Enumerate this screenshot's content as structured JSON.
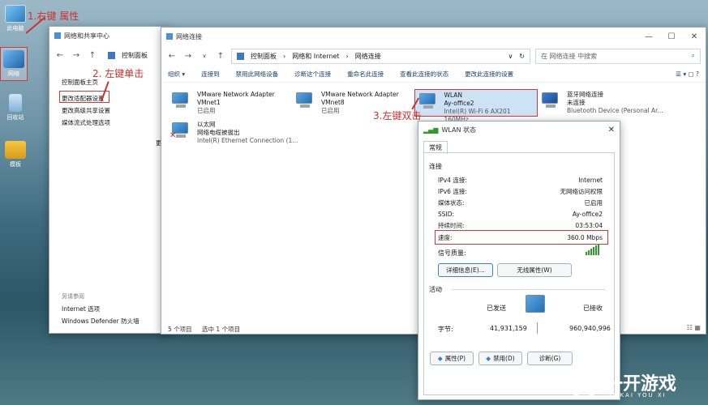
{
  "desktop": {
    "icons": [
      {
        "label": "此电脑"
      },
      {
        "label": "网络"
      },
      {
        "label": "回收站"
      },
      {
        "label": "模板"
      }
    ]
  },
  "annotations": {
    "step1": "1.右键 属性",
    "step2": "2. 左键单击",
    "step3": "3.左键双击"
  },
  "nsc_window": {
    "title": "网络和共享中心",
    "breadcrumb": "控制面板",
    "left_links": [
      "控制面板主页",
      "更改适配器设置",
      "更改高级共享设置",
      "媒体流式处理选项"
    ],
    "see_also": "另请参阅",
    "see_also_links": [
      "Internet 选项",
      "Windows Defender 防火墙"
    ],
    "partial_text": "更"
  },
  "net_window": {
    "title": "网络连接",
    "breadcrumb": [
      "控制面板",
      "网络和 Internet",
      "网络连接"
    ],
    "search_placeholder": "在 网络连接 中搜索",
    "commands": [
      "组织 ▾",
      "连接到",
      "禁用此网络设备",
      "诊断这个连接",
      "重命名此连接",
      "查看此连接的状态",
      "更改此连接的设置"
    ],
    "adapters": [
      {
        "name": "VMware Network Adapter",
        "line2": "VMnet1",
        "line3": "已启用"
      },
      {
        "name": "VMware Network Adapter",
        "line2": "VMnet8",
        "line3": "已启用"
      },
      {
        "name": "WLAN",
        "line2": "Ay-office2",
        "line3": "Intel(R) Wi-Fi 6 AX201 160MHz"
      },
      {
        "name": "蓝牙网络连接",
        "line2": "未连接",
        "line3": "Bluetooth Device (Personal Ar..."
      },
      {
        "name": "以太网",
        "line2": "网络电缆被拔出",
        "line3": "Intel(R) Ethernet Connection (1..."
      }
    ],
    "status_items": "5 个项目",
    "status_selected": "选中 1 个项目"
  },
  "wlan_dialog": {
    "title": "WLAN 状态",
    "tab": "常规",
    "section_connection": "连接",
    "rows": [
      {
        "k": "IPv4 连接:",
        "v": "Internet"
      },
      {
        "k": "IPv6 连接:",
        "v": "无网络访问权限"
      },
      {
        "k": "媒体状态:",
        "v": "已启用"
      },
      {
        "k": "SSID:",
        "v": "Ay-office2"
      },
      {
        "k": "持续时间:",
        "v": "03:53:04"
      },
      {
        "k": "速度:",
        "v": "360.0 Mbps"
      }
    ],
    "signal_label": "信号质量:",
    "btn_details": "详细信息(E)...",
    "btn_wireless": "无线属性(W)",
    "section_activity": "活动",
    "sent_label": "已发送",
    "recv_label": "已接收",
    "bytes_label": "字节:",
    "bytes_sent": "41,931,159",
    "bytes_recv": "960,940,996",
    "btn_props": "属性(P)",
    "btn_disable": "禁用(D)",
    "btn_diagnose": "诊断(G)"
  },
  "watermark": {
    "cn": "一开游戏",
    "en": "YI KAI YOU XI"
  }
}
